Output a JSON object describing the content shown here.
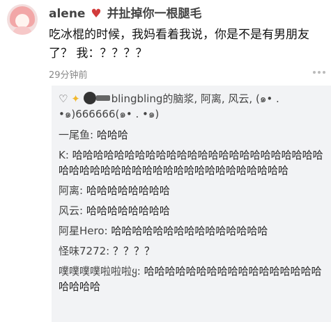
{
  "post": {
    "username": "alene",
    "username_suffix": "并扯掉你一根腿毛",
    "text": "吃冰棍的时候，我妈看着我说，你是不是有男朋友了？ 我：？？？？",
    "time": "29分钟前"
  },
  "reply_box": {
    "header_names": "blingbling的脑浆, 阿离, 风云, (๑• . •๑)666666(๑• . •๑)",
    "replies": [
      {
        "name": "一尾鱼:",
        "text": " 哈哈哈"
      },
      {
        "name": "K:",
        "text": " 哈哈哈哈哈哈哈哈哈哈哈哈哈哈哈哈哈哈哈哈哈哈哈哈哈哈哈哈哈哈哈哈哈哈哈哈哈哈哈哈哈哈哈哈哈哈"
      },
      {
        "name": "阿离:",
        "text": " 哈哈哈哈哈哈哈哈"
      },
      {
        "name": "风云:",
        "text": " 哈哈哈哈哈哈哈哈"
      },
      {
        "name": "阿星Hero:",
        "text": " 哈哈哈哈哈哈哈哈哈哈哈哈哈哈哈"
      },
      {
        "name": "怪味7272:",
        "text": " ？？？？"
      },
      {
        "name": "噗噗噗噗啦啦啦ყ:",
        "text": " 哈哈哈哈哈哈哈哈哈哈哈哈哈哈哈哈哈哈哈哈哈"
      }
    ]
  },
  "colors": {
    "reply_bg": "#f2f3f5",
    "time": "#888888",
    "heart": "#d23b3b"
  },
  "icons": [
    "heart-icon",
    "more-icon",
    "like-outline-icon",
    "sparkle-icon"
  ]
}
